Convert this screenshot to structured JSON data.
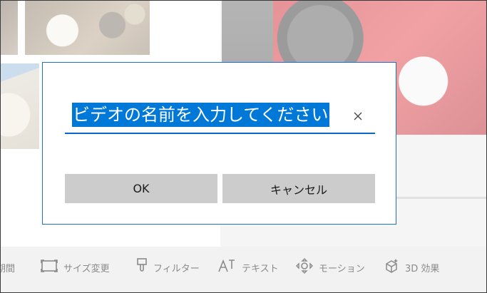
{
  "dialog": {
    "input_value": "ビデオの名前を入力してください",
    "ok_label": "OK",
    "cancel_label": "キャンセル"
  },
  "toolbar": {
    "items": [
      {
        "label": "期間",
        "icon": "clock-icon"
      },
      {
        "label": "サイズ変更",
        "icon": "resize-icon"
      },
      {
        "label": "フィルター",
        "icon": "filter-brush-icon"
      },
      {
        "label": "テキスト",
        "icon": "text-icon"
      },
      {
        "label": "モーション",
        "icon": "motion-icon"
      },
      {
        "label": "3D 効果",
        "icon": "3d-effects-icon"
      }
    ]
  },
  "colors": {
    "accent": "#0078d7",
    "dialog_border": "#1f73c5",
    "button_bg": "#cccccc",
    "toolbar_text": "#8a8a8a"
  }
}
